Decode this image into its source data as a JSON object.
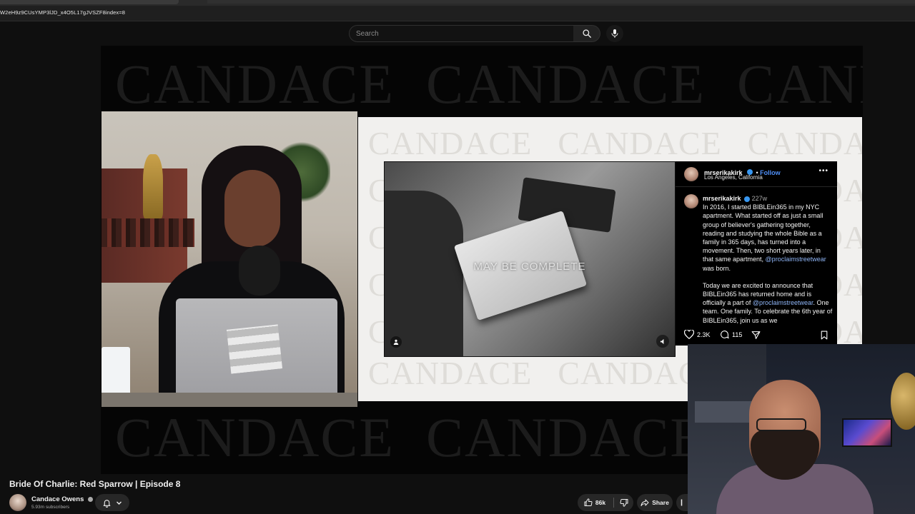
{
  "browser": {
    "url": "W2eH9z9CUsYMP3lJD_x4O5L17gJVSZF8index=8"
  },
  "masthead": {
    "search_placeholder": "Search",
    "icons": [
      "search-icon",
      "microphone-icon"
    ]
  },
  "video": {
    "watermark_word": "CANDACE",
    "slide_caption": "MAY BE COMPLETE",
    "instagram_post": {
      "handle": "mrserikakirk",
      "follow_label": "Follow",
      "location": "Los Angeles, California",
      "more_label": "•••",
      "comment_handle": "mrserikakirk",
      "comment_time": "227w",
      "paragraph1_a": "In 2016, I started BIBLEin365 in my NYC apartment. What started off as just a small group of believer's gathering together, reading and studying the whole Bible as a family in 365 days, has turned into a movement. Then, two short years later, in that same apartment, ",
      "paragraph1_mention": "@proclaimstreetwear",
      "paragraph1_b": " was born.",
      "paragraph2_a": "Today we are excited to announce that BIBLEin365 has returned home and is officially a part of ",
      "paragraph2_mention": "@proclaimstreetwear",
      "paragraph2_b": ". One team. One family. To celebrate the 6th year of BIBLEin365, join us as we",
      "likes": "2.3K",
      "comments": "115"
    }
  },
  "info": {
    "title": "Bride Of Charlie: Red Sparrow | Episode 8",
    "channel_name": "Candace Owens",
    "subscribers": "5.93m subscribers",
    "like_count": "86k",
    "share_label": "Share"
  },
  "colors": {
    "background": "#0f0f0f",
    "button_bg": "#272727",
    "ig_link": "#8eb4f5",
    "ig_follow": "#4f8ff7",
    "slide_bg": "#f1f0ee"
  }
}
